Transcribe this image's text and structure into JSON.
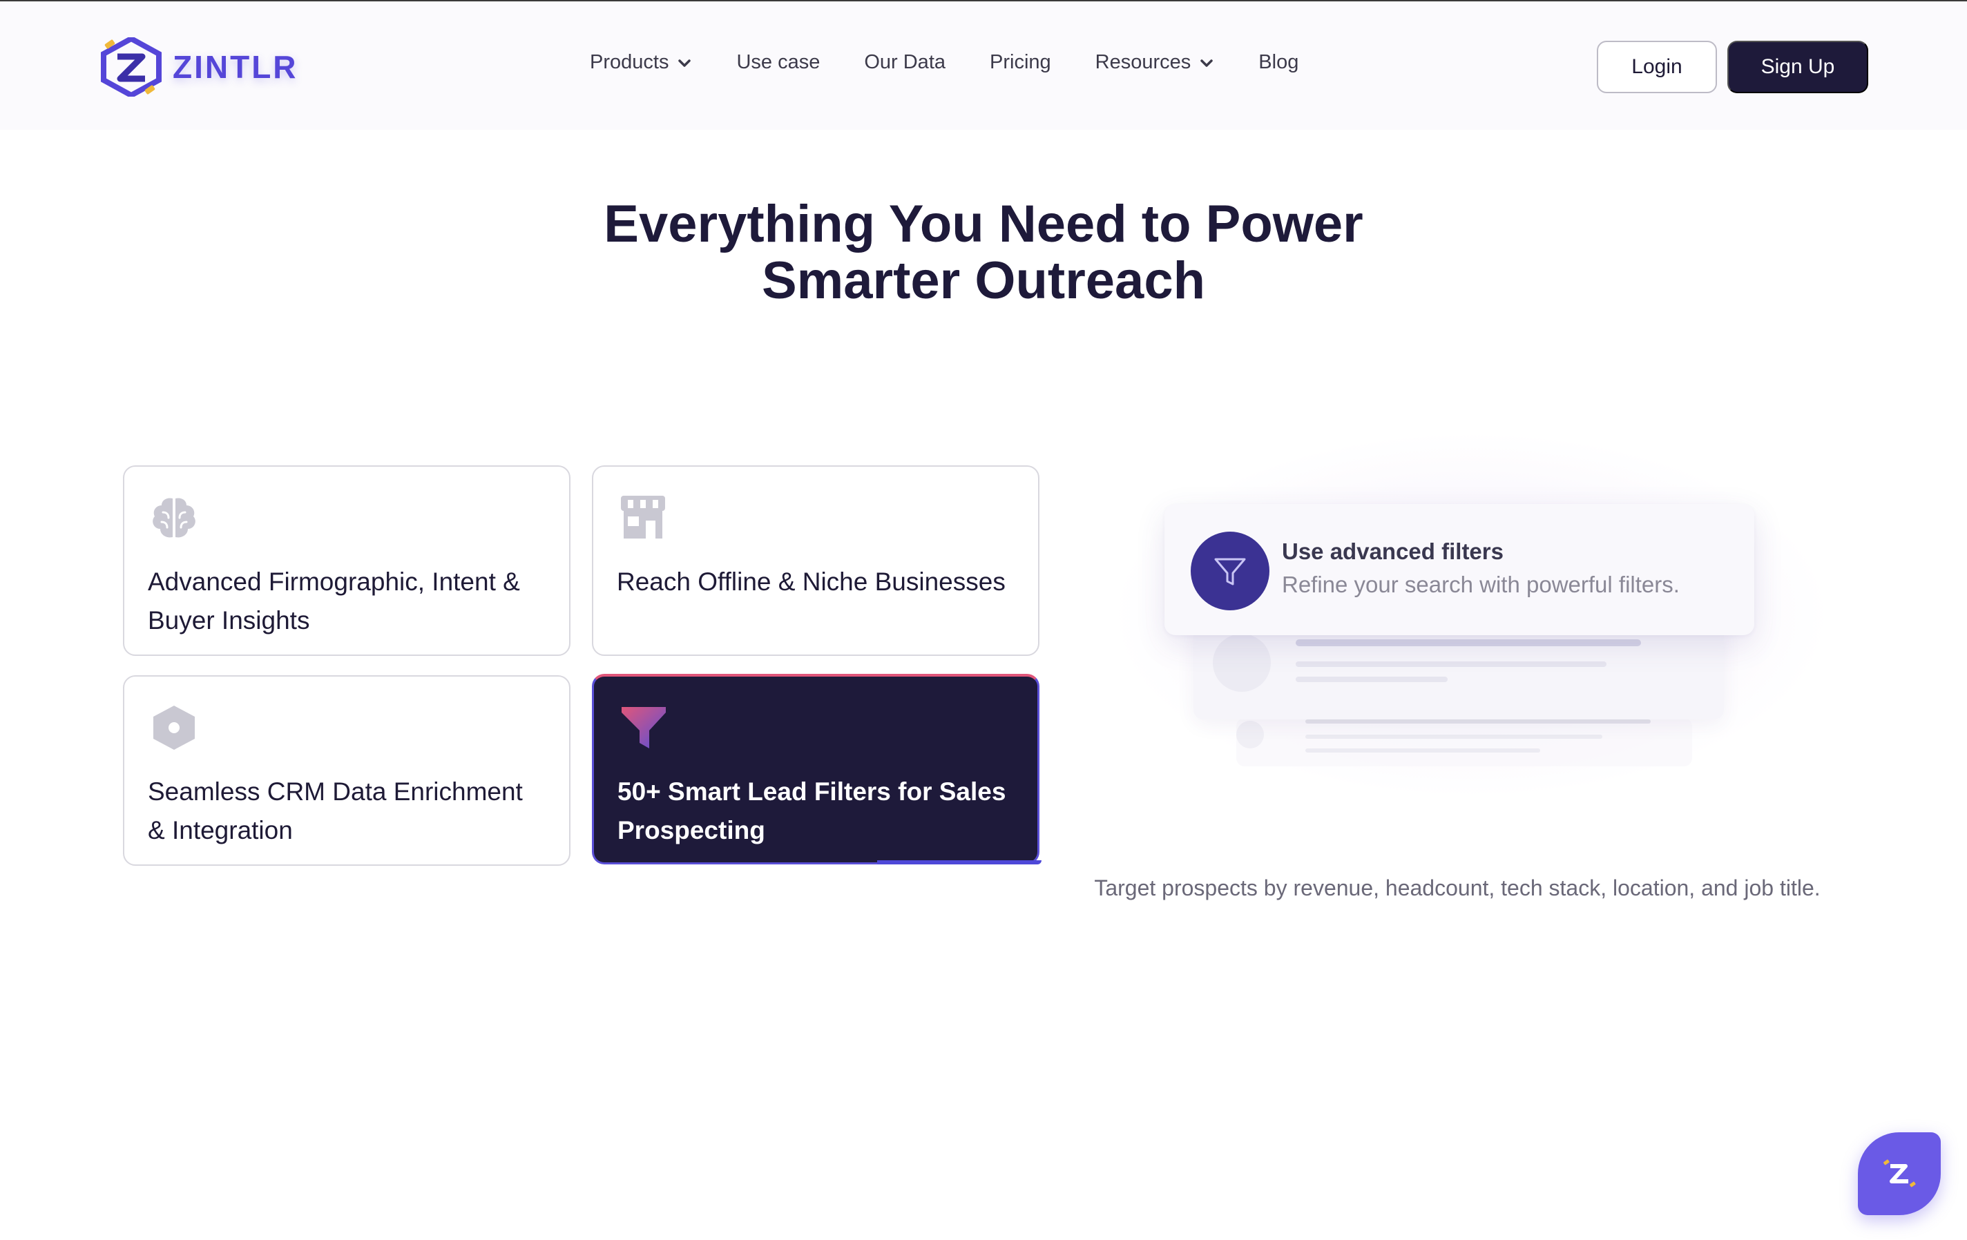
{
  "brand": {
    "name": "ZINTLR"
  },
  "nav": {
    "items": [
      {
        "label": "Products",
        "has_dropdown": true
      },
      {
        "label": "Use case",
        "has_dropdown": false
      },
      {
        "label": "Our Data",
        "has_dropdown": false
      },
      {
        "label": "Pricing",
        "has_dropdown": false
      },
      {
        "label": "Resources",
        "has_dropdown": true
      },
      {
        "label": "Blog",
        "has_dropdown": false
      }
    ],
    "login_label": "Login",
    "signup_label": "Sign Up"
  },
  "hero": {
    "title_line1": "Everything You Need to Power",
    "title_line2": "Smarter Outreach"
  },
  "features": [
    {
      "label": "Advanced Firmographic, Intent & Buyer Insights",
      "icon": "brain-icon",
      "active": false
    },
    {
      "label": "Reach Offline & Niche Businesses",
      "icon": "storefront-icon",
      "active": false
    },
    {
      "label": "Seamless CRM Data Enrichment & Integration",
      "icon": "hexagon-icon",
      "active": false
    },
    {
      "label": "50+ Smart Lead Filters for Sales Prospecting",
      "icon": "funnel-icon",
      "active": true
    }
  ],
  "preview": {
    "title": "Use advanced filters",
    "subtitle": "Refine your search with powerful filters.",
    "icon": "funnel-icon"
  },
  "description": "Target prospects by revenue, headcount, tech stack, location, and job title.",
  "colors": {
    "primary_dark": "#1e1a3a",
    "brand_purple": "#5546d8",
    "accent_pink": "#e0567a",
    "accent_blue": "#4e48d8",
    "chat_purple": "#6a5ae6"
  },
  "chat_widget": {
    "icon": "zintlr-logo-icon"
  }
}
